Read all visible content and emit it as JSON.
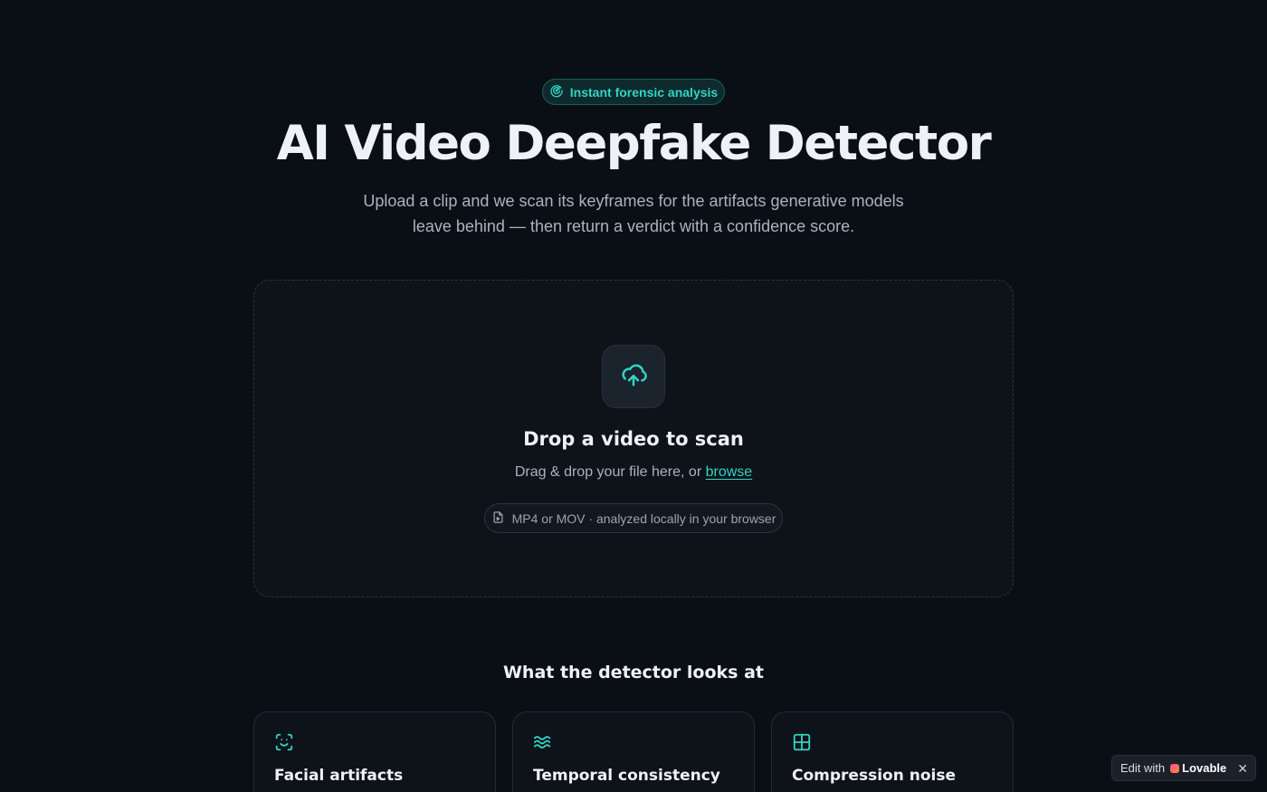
{
  "hero": {
    "badge_label": "Instant forensic analysis",
    "badge_icon": "scan-target-icon",
    "title": "AI Video Deepfake Detector",
    "subtitle": "Upload a clip and we scan its keyframes for the artifacts generative models leave behind — then return a verdict with a confidence score."
  },
  "dropzone": {
    "icon": "cloud-upload-icon",
    "title": "Drop a video to scan",
    "subtitle_prefix": "Drag & drop your file here, or ",
    "browse_label": "browse",
    "formats_icon": "file-icon",
    "formats": "MP4 or MOV · analyzed locally in your browser"
  },
  "features": {
    "title": "What the detector looks at",
    "cards": [
      {
        "title": "Facial artifacts",
        "icon": "face-scan-icon"
      },
      {
        "title": "Temporal consistency",
        "icon": "waves-icon"
      },
      {
        "title": "Compression noise",
        "icon": "grid-icon"
      }
    ]
  },
  "lovable_badge": {
    "prefix": "Edit with",
    "brand": "Lovable",
    "close": "✕"
  },
  "colors": {
    "accent": "#34d3c4",
    "background": "#0a0f16",
    "surface": "#0e131a"
  }
}
